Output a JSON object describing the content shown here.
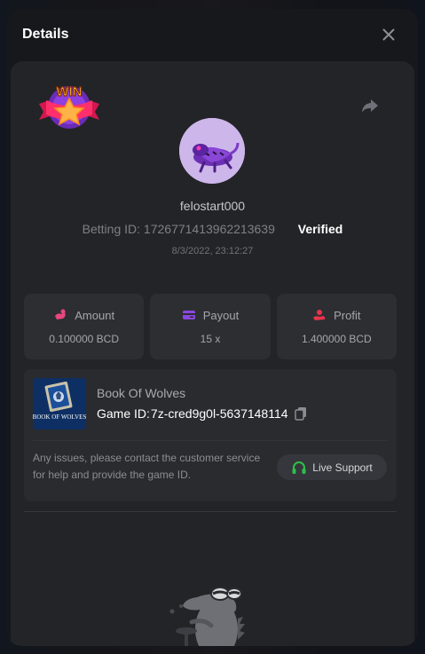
{
  "header": {
    "title": "Details"
  },
  "icons": {
    "close": "close-icon",
    "share": "share-icon",
    "win_badge": "win-badge-icon",
    "amount": "amount-icon",
    "payout": "payout-icon",
    "profit": "profit-icon",
    "copy": "copy-icon",
    "headset": "headset-icon"
  },
  "badge": {
    "text": "WIN"
  },
  "player": {
    "username": "felostart000",
    "betting_id_label": "Betting ID:",
    "betting_id": "1726771413962213639",
    "verified": "Verified",
    "timestamp": "8/3/2022, 23:12:27"
  },
  "stats": [
    {
      "label": "Amount",
      "value": "0.100000 BCD",
      "color": "#e8467c"
    },
    {
      "label": "Payout",
      "value": "15 x",
      "color": "#8b46e0"
    },
    {
      "label": "Profit",
      "value": "1.400000 BCD",
      "color": "#e8344a"
    }
  ],
  "game": {
    "name": "Book Of Wolves",
    "id_label": "Game ID:",
    "id": "7z-cred9g0l-5637148114",
    "thumb_text": "BOOK OF WOLVES"
  },
  "support": {
    "message": "Any issues, please contact the customer service for help and provide the game ID.",
    "button_label": "Live Support",
    "accent": "#2fbf4a"
  }
}
